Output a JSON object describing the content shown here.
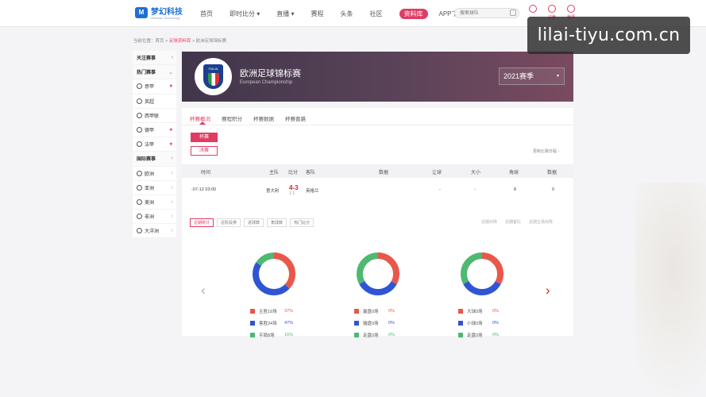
{
  "header": {
    "logo_mark": "M",
    "logo_text": "梦幻科技",
    "logo_sub": "Meihuan Technology",
    "nav": [
      "首页",
      "即时比分 ▾",
      "直播 ▾",
      "赛程",
      "头条",
      "社区",
      "资料库",
      "APP下载"
    ],
    "active_nav": "资料库",
    "search_placeholder": "搜索球队",
    "icons": [
      {
        "name": "message-icon",
        "label": ""
      },
      {
        "name": "register-icon",
        "label": "注册"
      },
      {
        "name": "login-icon",
        "label": "登录"
      }
    ]
  },
  "watermark": "lilai-tiyu.com.cn",
  "breadcrumb": {
    "prefix": "当前位置：首页 > ",
    "link": "足球资料库",
    "suffix": " > 欧洲足球锦标赛"
  },
  "sidebar": [
    {
      "label": "关注赛事",
      "type": "head",
      "marker": "›"
    },
    {
      "label": "热门赛事",
      "type": "head",
      "marker": "⌄"
    },
    {
      "label": "意甲",
      "type": "item",
      "marker": "★"
    },
    {
      "label": "英超",
      "type": "item",
      "marker": ""
    },
    {
      "label": "西甲联",
      "type": "item",
      "marker": ""
    },
    {
      "label": "德甲",
      "type": "item",
      "marker": "★"
    },
    {
      "label": "法甲",
      "type": "item",
      "marker": "★"
    },
    {
      "label": "国际赛事",
      "type": "head",
      "marker": "›"
    },
    {
      "label": "欧洲",
      "type": "item",
      "marker": "›"
    },
    {
      "label": "亚洲",
      "type": "item",
      "marker": "›"
    },
    {
      "label": "美洲",
      "type": "item",
      "marker": "›"
    },
    {
      "label": "非洲",
      "type": "item",
      "marker": "›"
    },
    {
      "label": "大洋洲",
      "type": "item",
      "marker": "›"
    }
  ],
  "banner": {
    "badge_text": "ITALIA",
    "title": "欧洲足球锦标赛",
    "subtitle": "European Championship",
    "season": "2021赛季",
    "season_caret": "▾"
  },
  "tabs": [
    "杯赛概况",
    "赛程积分",
    "杯赛数据",
    "杯赛晋路"
  ],
  "active_tab": "杯赛概况",
  "stages": {
    "on": "杯赛",
    "off": "决赛"
  },
  "right_note": "更新比赛日程 ›",
  "table": {
    "headers": [
      "时间",
      "主队",
      "比分",
      "客队",
      "数据",
      "让球",
      "大小",
      "角球",
      "数据"
    ],
    "row": {
      "time": "-07-12 03:00",
      "home": "意大利",
      "score": "4-3",
      "score_sub": "1-1",
      "away": "英格兰",
      "handicap": "-",
      "overunder": "-",
      "corners": "8",
      "data": "0"
    }
  },
  "sub_tabs": [
    "近期统计",
    "近阶段排",
    "进球数",
    "角球数",
    "热门比分"
  ],
  "active_sub_tab": "近期统计",
  "filters": [
    "近期对阵",
    "近期客队",
    "近期主场对阵"
  ],
  "donuts": [
    {
      "legend": [
        {
          "label": "主胜19场",
          "value": "37%",
          "color": "#e8584a"
        },
        {
          "label": "客胜24场",
          "value": "47%",
          "color": "#2f55d4"
        },
        {
          "label": "平局8场",
          "value": "16%",
          "color": "#4fb871"
        }
      ],
      "fractions": [
        0.37,
        0.47,
        0.16
      ]
    },
    {
      "legend": [
        {
          "label": "赢盘0场",
          "value": "0%",
          "color": "#e8584a"
        },
        {
          "label": "输盘0场",
          "value": "0%",
          "color": "#2f55d4"
        },
        {
          "label": "走盘0场",
          "value": "0%",
          "color": "#4fb871"
        }
      ],
      "fractions": [
        0.33,
        0.34,
        0.33
      ]
    },
    {
      "legend": [
        {
          "label": "大球0场",
          "value": "0%",
          "color": "#e8584a"
        },
        {
          "label": "小球0场",
          "value": "0%",
          "color": "#2f55d4"
        },
        {
          "label": "走盘0场",
          "value": "0%",
          "color": "#4fb871"
        }
      ],
      "fractions": [
        0.33,
        0.34,
        0.33
      ]
    }
  ],
  "arrows": {
    "left": "‹",
    "right": "›"
  }
}
